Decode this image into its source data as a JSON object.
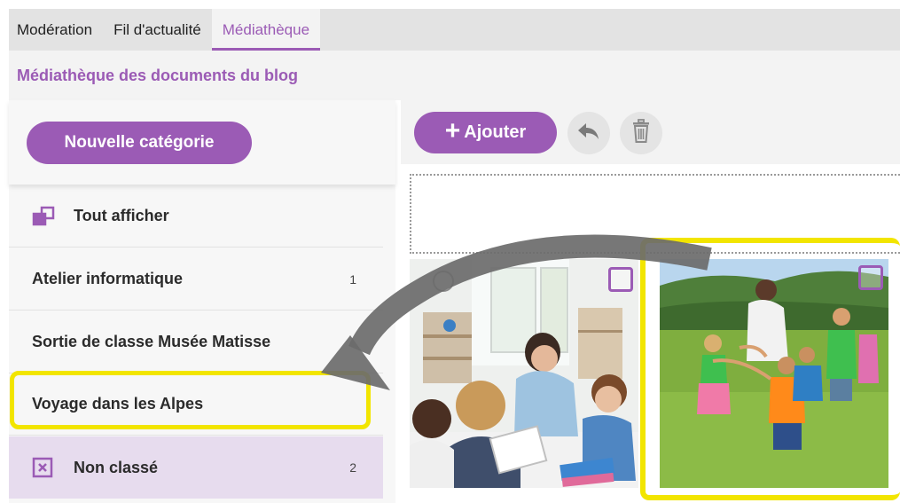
{
  "tabs": [
    {
      "label": "Modération",
      "active": false
    },
    {
      "label": "Fil d'actualité",
      "active": false
    },
    {
      "label": "Médiathèque",
      "active": true
    }
  ],
  "subtitle": "Médiathèque des documents du blog",
  "sidebar": {
    "new_category_label": "Nouvelle catégorie",
    "items": [
      {
        "label": "Tout afficher",
        "icon": "show-all-icon",
        "count": ""
      },
      {
        "label": "Atelier informatique",
        "count": "1"
      },
      {
        "label": "Sortie de classe Musée Matisse",
        "count": ""
      },
      {
        "label": "Voyage dans les Alpes",
        "count": ""
      },
      {
        "label": "Non classé",
        "icon": "unclassified-icon",
        "count": "2"
      }
    ]
  },
  "toolbar": {
    "add_label": "Ajouter",
    "add_icon": "plus-icon",
    "undo_icon": "undo-icon",
    "trash_icon": "trash-icon"
  },
  "media": [
    {
      "subject": "classroom-photo",
      "selected": false
    },
    {
      "subject": "children-outdoor-photo",
      "selected": false
    }
  ],
  "colors": {
    "accent": "#9b5bb5",
    "highlight": "#f2e500",
    "selected_bg": "#e7dcee",
    "arrow": "#6b6b6b"
  }
}
